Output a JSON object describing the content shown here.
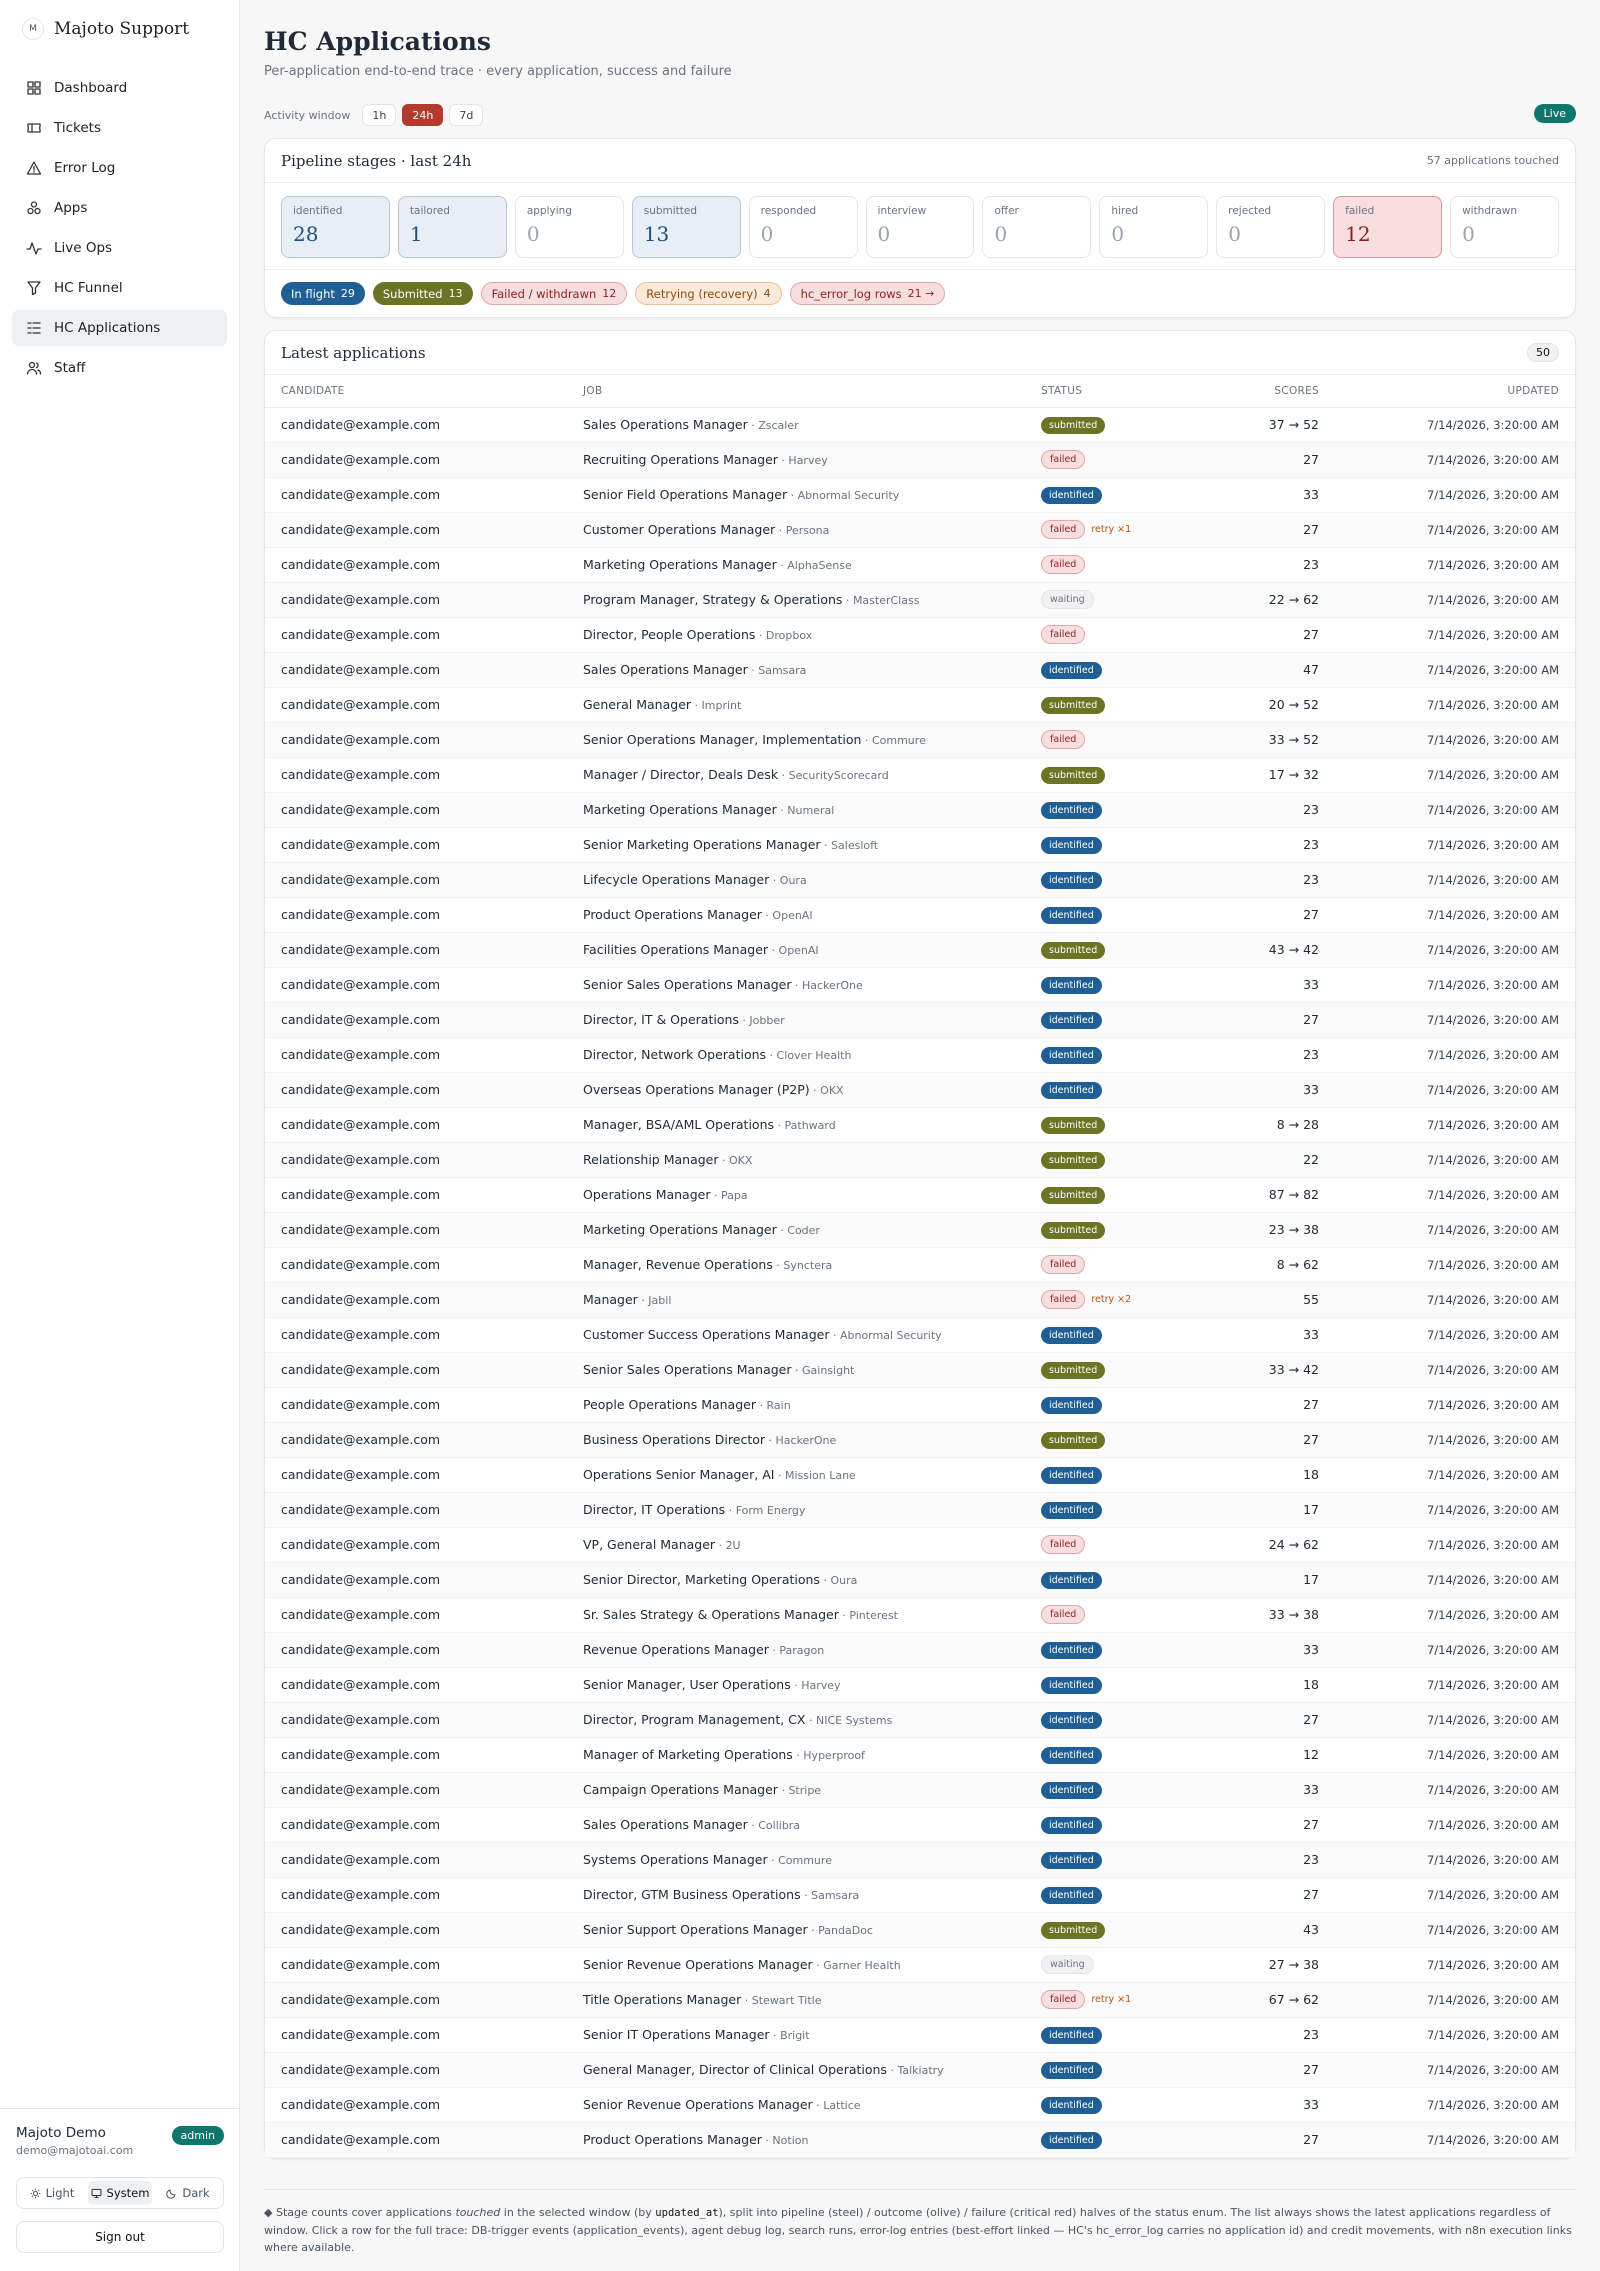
{
  "brand": {
    "logo_text": "M",
    "name": "Majoto Support"
  },
  "nav": [
    {
      "label": "Dashboard",
      "icon": "grid-icon",
      "active": false
    },
    {
      "label": "Tickets",
      "icon": "ticket-icon",
      "active": false
    },
    {
      "label": "Error Log",
      "icon": "warning-icon",
      "active": false
    },
    {
      "label": "Apps",
      "icon": "apps-icon",
      "active": false
    },
    {
      "label": "Live Ops",
      "icon": "activity-icon",
      "active": false
    },
    {
      "label": "HC Funnel",
      "icon": "funnel-icon",
      "active": false
    },
    {
      "label": "HC Applications",
      "icon": "list-icon",
      "active": true
    },
    {
      "label": "Staff",
      "icon": "users-icon",
      "active": false
    }
  ],
  "user": {
    "name": "Majoto Demo",
    "email": "demo@majotoai.com",
    "role": "admin"
  },
  "theme": {
    "light": "Light",
    "system": "System",
    "dark": "Dark",
    "selected": "system"
  },
  "signout_label": "Sign out",
  "page": {
    "title": "HC Applications",
    "subtitle": "Per-application end-to-end trace · every application, success and failure"
  },
  "window": {
    "label": "Activity window",
    "options": [
      "1h",
      "24h",
      "7d"
    ],
    "selected": "24h",
    "live": "Live"
  },
  "pipeline": {
    "title": "Pipeline stages · last 24h",
    "meta": "57 applications touched",
    "stages": [
      {
        "label": "identified",
        "count": "28",
        "tone": "steel"
      },
      {
        "label": "tailored",
        "count": "1",
        "tone": "steel"
      },
      {
        "label": "applying",
        "count": "0",
        "tone": ""
      },
      {
        "label": "submitted",
        "count": "13",
        "tone": "steel"
      },
      {
        "label": "responded",
        "count": "0",
        "tone": ""
      },
      {
        "label": "interview",
        "count": "0",
        "tone": ""
      },
      {
        "label": "offer",
        "count": "0",
        "tone": ""
      },
      {
        "label": "hired",
        "count": "0",
        "tone": ""
      },
      {
        "label": "rejected",
        "count": "0",
        "tone": ""
      },
      {
        "label": "failed",
        "count": "12",
        "tone": "crit"
      },
      {
        "label": "withdrawn",
        "count": "0",
        "tone": ""
      }
    ],
    "summary": [
      {
        "label": "In flight",
        "count": "29",
        "cls": "p-inflight"
      },
      {
        "label": "Submitted",
        "count": "13",
        "cls": "p-sub"
      },
      {
        "label": "Failed / withdrawn",
        "count": "12",
        "cls": "p-fail"
      },
      {
        "label": "Retrying (recovery)",
        "count": "4",
        "cls": "p-retry"
      },
      {
        "label": "hc_error_log rows",
        "count": "21 →",
        "cls": "p-err"
      }
    ]
  },
  "latest": {
    "title": "Latest applications",
    "count": "50",
    "columns": {
      "candidate": "CANDIDATE",
      "job": "JOB",
      "status": "STATUS",
      "scores": "SCORES",
      "updated": "UPDATED"
    },
    "rows": [
      {
        "c": "candidate@example.com",
        "t": "Sales Operations Manager",
        "co": "Zscaler",
        "s": "submitted",
        "r": "",
        "sc": "37 → 52",
        "u": "7/14/2026, 3:20:00 AM"
      },
      {
        "c": "candidate@example.com",
        "t": "Recruiting Operations Manager",
        "co": "Harvey",
        "s": "failed",
        "r": "",
        "sc": "27",
        "u": "7/14/2026, 3:20:00 AM"
      },
      {
        "c": "candidate@example.com",
        "t": "Senior Field Operations Manager",
        "co": "Abnormal Security",
        "s": "identified",
        "r": "",
        "sc": "33",
        "u": "7/14/2026, 3:20:00 AM"
      },
      {
        "c": "candidate@example.com",
        "t": "Customer Operations Manager",
        "co": "Persona",
        "s": "failed",
        "r": "retry ×1",
        "sc": "27",
        "u": "7/14/2026, 3:20:00 AM"
      },
      {
        "c": "candidate@example.com",
        "t": "Marketing Operations Manager",
        "co": "AlphaSense",
        "s": "failed",
        "r": "",
        "sc": "23",
        "u": "7/14/2026, 3:20:00 AM"
      },
      {
        "c": "candidate@example.com",
        "t": "Program Manager, Strategy & Operations",
        "co": "MasterClass",
        "s": "waiting",
        "r": "",
        "sc": "22 → 62",
        "u": "7/14/2026, 3:20:00 AM"
      },
      {
        "c": "candidate@example.com",
        "t": "Director, People Operations",
        "co": "Dropbox",
        "s": "failed",
        "r": "",
        "sc": "27",
        "u": "7/14/2026, 3:20:00 AM"
      },
      {
        "c": "candidate@example.com",
        "t": "Sales Operations Manager",
        "co": "Samsara",
        "s": "identified",
        "r": "",
        "sc": "47",
        "u": "7/14/2026, 3:20:00 AM"
      },
      {
        "c": "candidate@example.com",
        "t": "General Manager",
        "co": "Imprint",
        "s": "submitted",
        "r": "",
        "sc": "20 → 52",
        "u": "7/14/2026, 3:20:00 AM"
      },
      {
        "c": "candidate@example.com",
        "t": "Senior Operations Manager, Implementation",
        "co": "Commure",
        "s": "failed",
        "r": "",
        "sc": "33 → 52",
        "u": "7/14/2026, 3:20:00 AM"
      },
      {
        "c": "candidate@example.com",
        "t": "Manager / Director, Deals Desk",
        "co": "SecurityScorecard",
        "s": "submitted",
        "r": "",
        "sc": "17 → 32",
        "u": "7/14/2026, 3:20:00 AM"
      },
      {
        "c": "candidate@example.com",
        "t": "Marketing Operations Manager",
        "co": "Numeral",
        "s": "identified",
        "r": "",
        "sc": "23",
        "u": "7/14/2026, 3:20:00 AM"
      },
      {
        "c": "candidate@example.com",
        "t": "Senior Marketing Operations Manager",
        "co": "Salesloft",
        "s": "identified",
        "r": "",
        "sc": "23",
        "u": "7/14/2026, 3:20:00 AM"
      },
      {
        "c": "candidate@example.com",
        "t": "Lifecycle Operations Manager",
        "co": "Oura",
        "s": "identified",
        "r": "",
        "sc": "23",
        "u": "7/14/2026, 3:20:00 AM"
      },
      {
        "c": "candidate@example.com",
        "t": "Product Operations Manager",
        "co": "OpenAI",
        "s": "identified",
        "r": "",
        "sc": "27",
        "u": "7/14/2026, 3:20:00 AM"
      },
      {
        "c": "candidate@example.com",
        "t": "Facilities Operations Manager",
        "co": "OpenAI",
        "s": "submitted",
        "r": "",
        "sc": "43 → 42",
        "u": "7/14/2026, 3:20:00 AM"
      },
      {
        "c": "candidate@example.com",
        "t": "Senior Sales Operations Manager",
        "co": "HackerOne",
        "s": "identified",
        "r": "",
        "sc": "33",
        "u": "7/14/2026, 3:20:00 AM"
      },
      {
        "c": "candidate@example.com",
        "t": "Director, IT & Operations",
        "co": "Jobber",
        "s": "identified",
        "r": "",
        "sc": "27",
        "u": "7/14/2026, 3:20:00 AM"
      },
      {
        "c": "candidate@example.com",
        "t": "Director, Network Operations",
        "co": "Clover Health",
        "s": "identified",
        "r": "",
        "sc": "23",
        "u": "7/14/2026, 3:20:00 AM"
      },
      {
        "c": "candidate@example.com",
        "t": "Overseas Operations Manager (P2P)",
        "co": "OKX",
        "s": "identified",
        "r": "",
        "sc": "33",
        "u": "7/14/2026, 3:20:00 AM"
      },
      {
        "c": "candidate@example.com",
        "t": "Manager, BSA/AML Operations",
        "co": "Pathward",
        "s": "submitted",
        "r": "",
        "sc": "8 → 28",
        "u": "7/14/2026, 3:20:00 AM"
      },
      {
        "c": "candidate@example.com",
        "t": "Relationship Manager",
        "co": "OKX",
        "s": "submitted",
        "r": "",
        "sc": "22",
        "u": "7/14/2026, 3:20:00 AM"
      },
      {
        "c": "candidate@example.com",
        "t": "Operations Manager",
        "co": "Papa",
        "s": "submitted",
        "r": "",
        "sc": "87 → 82",
        "u": "7/14/2026, 3:20:00 AM"
      },
      {
        "c": "candidate@example.com",
        "t": "Marketing Operations Manager",
        "co": "Coder",
        "s": "submitted",
        "r": "",
        "sc": "23 → 38",
        "u": "7/14/2026, 3:20:00 AM"
      },
      {
        "c": "candidate@example.com",
        "t": "Manager, Revenue Operations",
        "co": "Synctera",
        "s": "failed",
        "r": "",
        "sc": "8 → 62",
        "u": "7/14/2026, 3:20:00 AM"
      },
      {
        "c": "candidate@example.com",
        "t": "Manager",
        "co": "Jabil",
        "s": "failed",
        "r": "retry ×2",
        "sc": "55",
        "u": "7/14/2026, 3:20:00 AM"
      },
      {
        "c": "candidate@example.com",
        "t": "Customer Success Operations Manager",
        "co": "Abnormal Security",
        "s": "identified",
        "r": "",
        "sc": "33",
        "u": "7/14/2026, 3:20:00 AM"
      },
      {
        "c": "candidate@example.com",
        "t": "Senior Sales Operations Manager",
        "co": "Gainsight",
        "s": "submitted",
        "r": "",
        "sc": "33 → 42",
        "u": "7/14/2026, 3:20:00 AM"
      },
      {
        "c": "candidate@example.com",
        "t": "People Operations Manager",
        "co": "Rain",
        "s": "identified",
        "r": "",
        "sc": "27",
        "u": "7/14/2026, 3:20:00 AM"
      },
      {
        "c": "candidate@example.com",
        "t": "Business Operations Director",
        "co": "HackerOne",
        "s": "submitted",
        "r": "",
        "sc": "27",
        "u": "7/14/2026, 3:20:00 AM"
      },
      {
        "c": "candidate@example.com",
        "t": "Operations Senior Manager, AI",
        "co": "Mission Lane",
        "s": "identified",
        "r": "",
        "sc": "18",
        "u": "7/14/2026, 3:20:00 AM"
      },
      {
        "c": "candidate@example.com",
        "t": "Director, IT Operations",
        "co": "Form Energy",
        "s": "identified",
        "r": "",
        "sc": "17",
        "u": "7/14/2026, 3:20:00 AM"
      },
      {
        "c": "candidate@example.com",
        "t": "VP, General Manager",
        "co": "2U",
        "s": "failed",
        "r": "",
        "sc": "24 → 62",
        "u": "7/14/2026, 3:20:00 AM"
      },
      {
        "c": "candidate@example.com",
        "t": "Senior Director, Marketing Operations",
        "co": "Oura",
        "s": "identified",
        "r": "",
        "sc": "17",
        "u": "7/14/2026, 3:20:00 AM"
      },
      {
        "c": "candidate@example.com",
        "t": "Sr. Sales Strategy & Operations Manager",
        "co": "Pinterest",
        "s": "failed",
        "r": "",
        "sc": "33 → 38",
        "u": "7/14/2026, 3:20:00 AM"
      },
      {
        "c": "candidate@example.com",
        "t": "Revenue Operations Manager",
        "co": "Paragon",
        "s": "identified",
        "r": "",
        "sc": "33",
        "u": "7/14/2026, 3:20:00 AM"
      },
      {
        "c": "candidate@example.com",
        "t": "Senior Manager, User Operations",
        "co": "Harvey",
        "s": "identified",
        "r": "",
        "sc": "18",
        "u": "7/14/2026, 3:20:00 AM"
      },
      {
        "c": "candidate@example.com",
        "t": "Director, Program Management, CX",
        "co": "NICE Systems",
        "s": "identified",
        "r": "",
        "sc": "27",
        "u": "7/14/2026, 3:20:00 AM"
      },
      {
        "c": "candidate@example.com",
        "t": "Manager of Marketing Operations",
        "co": "Hyperproof",
        "s": "identified",
        "r": "",
        "sc": "12",
        "u": "7/14/2026, 3:20:00 AM"
      },
      {
        "c": "candidate@example.com",
        "t": "Campaign Operations Manager",
        "co": "Stripe",
        "s": "identified",
        "r": "",
        "sc": "33",
        "u": "7/14/2026, 3:20:00 AM"
      },
      {
        "c": "candidate@example.com",
        "t": "Sales Operations Manager",
        "co": "Collibra",
        "s": "identified",
        "r": "",
        "sc": "27",
        "u": "7/14/2026, 3:20:00 AM"
      },
      {
        "c": "candidate@example.com",
        "t": "Systems Operations Manager",
        "co": "Commure",
        "s": "identified",
        "r": "",
        "sc": "23",
        "u": "7/14/2026, 3:20:00 AM"
      },
      {
        "c": "candidate@example.com",
        "t": "Director, GTM Business Operations",
        "co": "Samsara",
        "s": "identified",
        "r": "",
        "sc": "27",
        "u": "7/14/2026, 3:20:00 AM"
      },
      {
        "c": "candidate@example.com",
        "t": "Senior Support Operations Manager",
        "co": "PandaDoc",
        "s": "submitted",
        "r": "",
        "sc": "43",
        "u": "7/14/2026, 3:20:00 AM"
      },
      {
        "c": "candidate@example.com",
        "t": "Senior Revenue Operations Manager",
        "co": "Garner Health",
        "s": "waiting",
        "r": "",
        "sc": "27 → 38",
        "u": "7/14/2026, 3:20:00 AM"
      },
      {
        "c": "candidate@example.com",
        "t": "Title Operations Manager",
        "co": "Stewart Title",
        "s": "failed",
        "r": "retry ×1",
        "sc": "67 → 62",
        "u": "7/14/2026, 3:20:00 AM"
      },
      {
        "c": "candidate@example.com",
        "t": "Senior IT Operations Manager",
        "co": "Brigit",
        "s": "identified",
        "r": "",
        "sc": "23",
        "u": "7/14/2026, 3:20:00 AM"
      },
      {
        "c": "candidate@example.com",
        "t": "General Manager, Director of Clinical Operations",
        "co": "Talkiatry",
        "s": "identified",
        "r": "",
        "sc": "27",
        "u": "7/14/2026, 3:20:00 AM"
      },
      {
        "c": "candidate@example.com",
        "t": "Senior Revenue Operations Manager",
        "co": "Lattice",
        "s": "identified",
        "r": "",
        "sc": "33",
        "u": "7/14/2026, 3:20:00 AM"
      },
      {
        "c": "candidate@example.com",
        "t": "Product Operations Manager",
        "co": "Notion",
        "s": "identified",
        "r": "",
        "sc": "27",
        "u": "7/14/2026, 3:20:00 AM"
      }
    ]
  },
  "footnote": {
    "p1": "◆ Stage counts cover applications ",
    "em": "touched",
    "p2": " in the selected window (by ",
    "code": "updated_at",
    "p3": "), split into pipeline (steel) / outcome (olive) / failure (critical red) halves of the status enum. The list always shows the latest applications regardless of window. Click a row for the full trace: DB-trigger events (application_events), agent debug log, search runs, error-log entries (best-effort linked — HC's hc_error_log carries no application id) and credit movements, with n8n execution links where available."
  },
  "colors": {
    "accent": "#b23b2e",
    "steel": "#1f5f95",
    "olive": "#6b7325",
    "critical": "#8f1f1f",
    "teal": "#0f766e"
  }
}
